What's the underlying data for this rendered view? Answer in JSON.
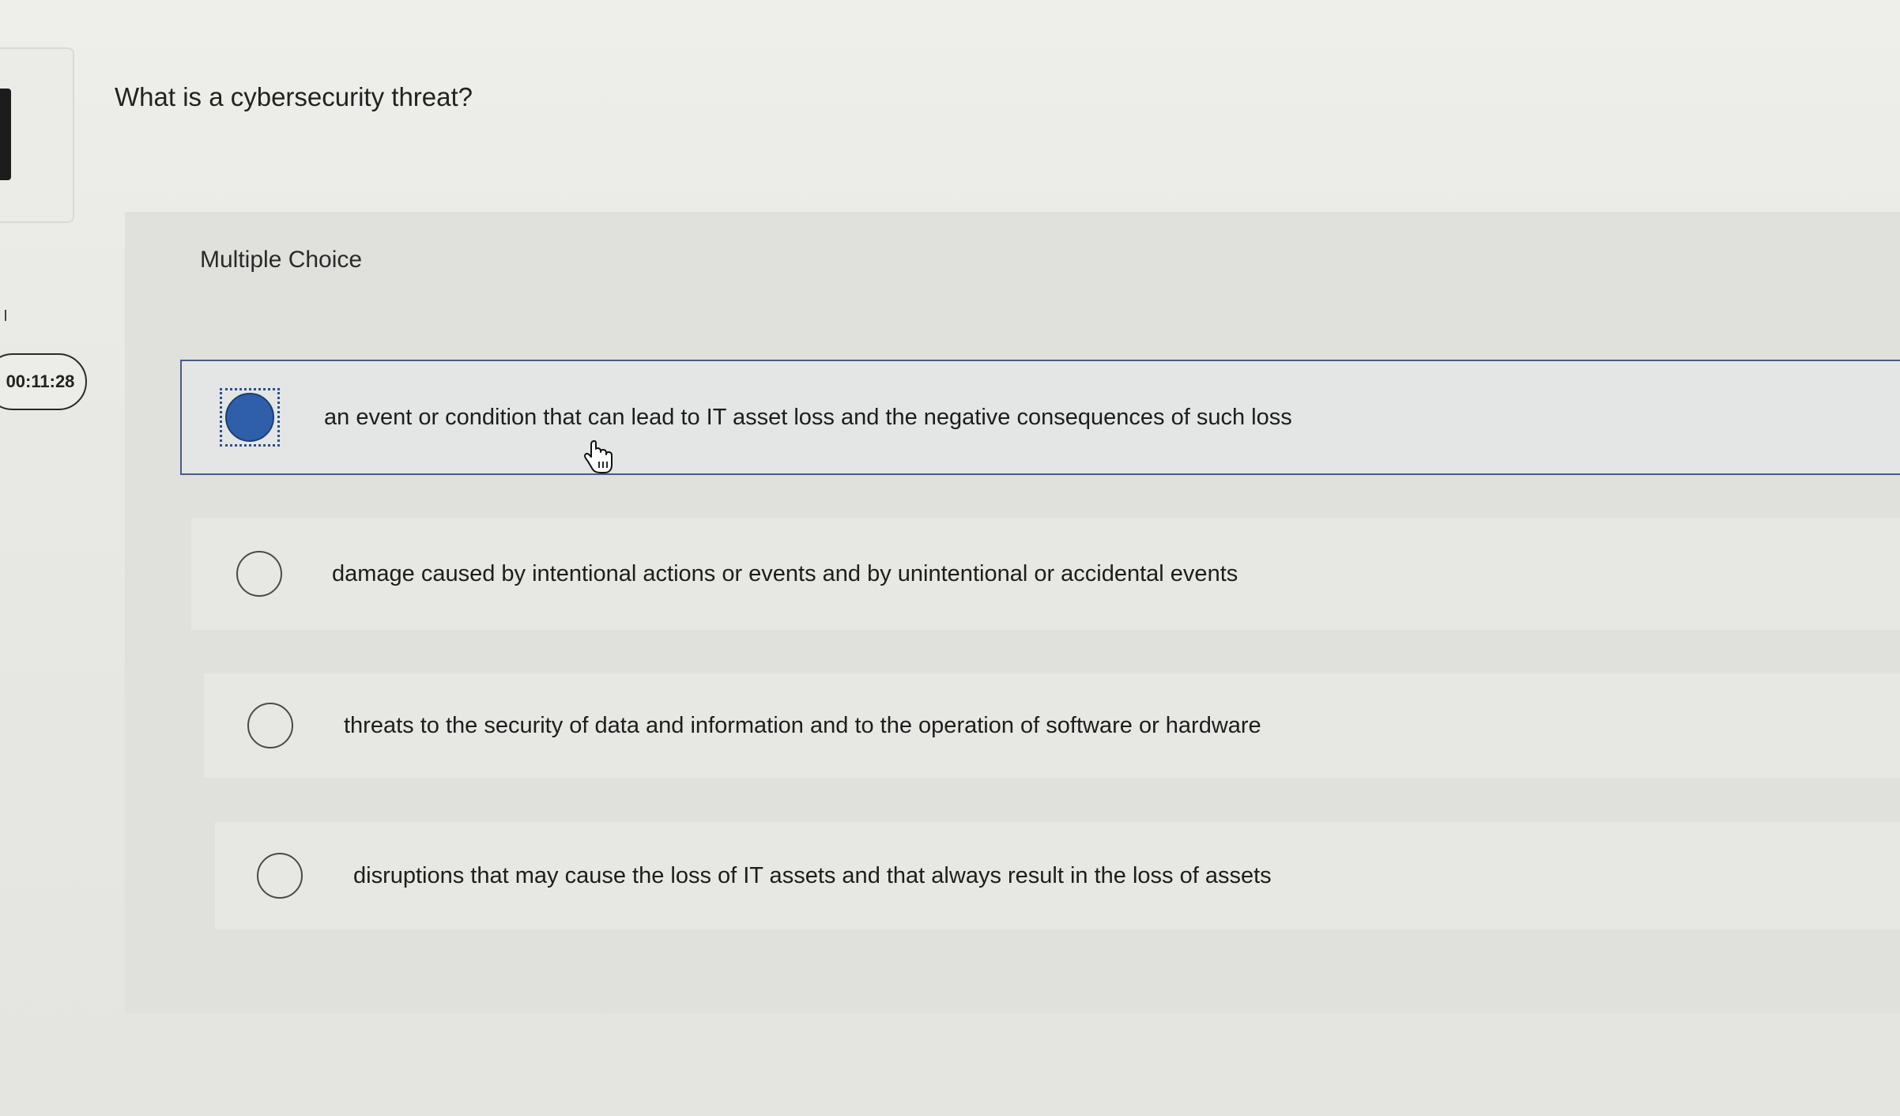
{
  "question": {
    "text": "What is a cybersecurity threat?"
  },
  "timer": {
    "value": "00:11:28"
  },
  "choices": {
    "type_label": "Multiple Choice",
    "selected_index": 0,
    "options": [
      {
        "text": "an event or condition that can lead to IT asset loss and the negative consequences of such loss",
        "selected": true
      },
      {
        "text": "damage caused by intentional actions or events and by unintentional or accidental events",
        "selected": false
      },
      {
        "text": "threats to the security of data and information and to the operation of software or hardware",
        "selected": false
      },
      {
        "text": "disruptions that may cause the loss of IT assets and that always result in the loss of assets",
        "selected": false
      }
    ]
  },
  "colors": {
    "selected_radio": "#2f5fa8",
    "selected_border": "#4a5a86",
    "panel_bg": "#e0e0dc"
  },
  "icons": {
    "cursor": "hand-pointer-icon"
  }
}
